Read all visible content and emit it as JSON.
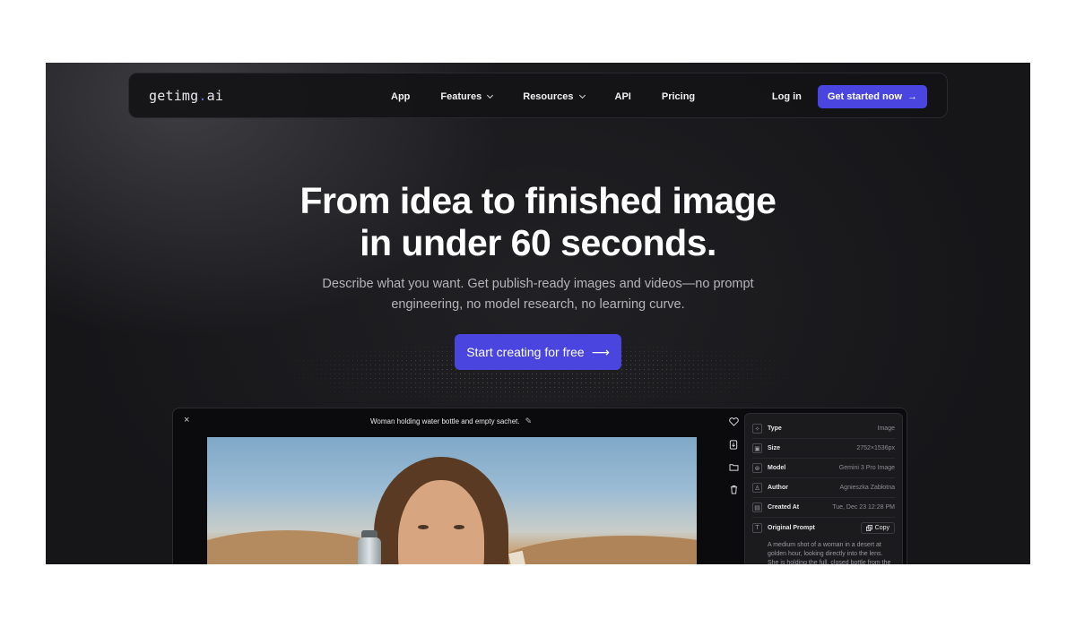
{
  "nav": {
    "logo_main": "getimg",
    "logo_dot": ".",
    "logo_tld": "ai",
    "links": [
      {
        "label": "App",
        "dropdown": false
      },
      {
        "label": "Features",
        "dropdown": true
      },
      {
        "label": "Resources",
        "dropdown": true
      },
      {
        "label": "API",
        "dropdown": false
      },
      {
        "label": "Pricing",
        "dropdown": false
      }
    ],
    "login": "Log in",
    "cta": "Get started now",
    "cta_arrow": "→"
  },
  "hero": {
    "title_line1": "From idea to finished image",
    "title_line2": "in under 60 seconds.",
    "subtitle_line1": "Describe what you want. Get publish-ready images and videos—no prompt",
    "subtitle_line2": "engineering, no model research, no learning curve.",
    "cta": "Start creating for free",
    "cta_arrow": "⟶"
  },
  "preview": {
    "close_icon": "×",
    "image_title": "Woman holding water bottle and empty sachet.",
    "edit_icon": "✎",
    "side_icons": [
      "heart-icon",
      "download-icon",
      "folder-icon",
      "trash-icon"
    ],
    "info": {
      "rows": [
        {
          "icon": "✧",
          "label": "Type",
          "value": "Image"
        },
        {
          "icon": "▣",
          "label": "Size",
          "value": "2752×1536px"
        },
        {
          "icon": "⊛",
          "label": "Model",
          "value": "Gemini 3 Pro Image"
        },
        {
          "icon": "♙",
          "label": "Author",
          "value": "Agnieszka Zabłotna"
        },
        {
          "icon": "▤",
          "label": "Created At",
          "value": "Tue, Dec 23 12:28 PM"
        }
      ],
      "prompt_icon": "T",
      "prompt_label": "Original Prompt",
      "copy_label": "Copy",
      "prompt_text": "A medium shot of a woman in a desert at golden hour, looking directly into the lens. She is holding the full, closed bottle from the"
    }
  },
  "colors": {
    "accent": "#4b45e0",
    "background": "#161619"
  }
}
